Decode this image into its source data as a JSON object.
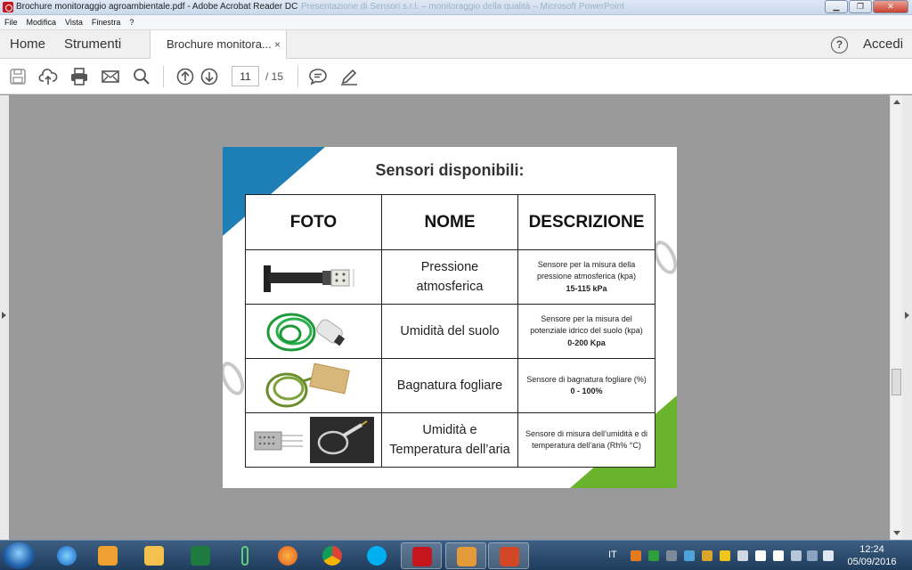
{
  "window": {
    "title": "Brochure monitoraggio agroambientale.pdf - Adobe Acrobat Reader DC",
    "background_title": "Presentazione di Sensori s.r.l. – monitoraggio della qualità – Microsoft PowerPoint"
  },
  "menu": [
    "File",
    "Modifica",
    "Vista",
    "Finestra",
    "?"
  ],
  "tabs": {
    "home": "Home",
    "tools": "Strumenti",
    "document": "Brochure monitora...",
    "close": "×",
    "signin": "Accedi",
    "help": "?"
  },
  "toolbar": {
    "icons": [
      "save-icon",
      "upload-icon",
      "print-icon",
      "email-icon",
      "search-icon",
      "arrow-up-icon",
      "arrow-down-icon",
      "comment-icon",
      "pen-icon"
    ],
    "current_page": "11",
    "total_pages": "/ 15"
  },
  "document": {
    "heading": "Sensori disponibili:",
    "columns": [
      "FOTO",
      "NOME",
      "DESCRIZIONE"
    ],
    "rows": [
      {
        "name_lines": [
          "Pressione",
          "atmosferica"
        ],
        "desc_lines": [
          "Sensore per la misura della",
          "pressione atmosferica (kpa)"
        ],
        "range": "15-115 kPa"
      },
      {
        "name_lines": [
          "Umidità del suolo"
        ],
        "desc_lines": [
          "Sensore per la misura del",
          "potenziale idrico del suolo (kpa)"
        ],
        "range": "0-200 Kpa"
      },
      {
        "name_lines": [
          "Bagnatura fogliare"
        ],
        "desc_lines": [
          "Sensore di bagnatura fogliare (%)"
        ],
        "range": "0 - 100%"
      },
      {
        "name_lines": [
          "Umidità e",
          "Temperatura dell’aria"
        ],
        "desc_lines": [
          "Sensore di misura dell’umidità e di",
          "temperatura dell’aria (Rh%  °C)"
        ],
        "range": ""
      }
    ],
    "colors": {
      "blue_corner": "#1e7fb6",
      "green_corner": "#6ab42d"
    }
  },
  "taskbar": {
    "apps": [
      "ie-icon",
      "media-player-icon",
      "explorer-icon",
      "excel-icon",
      "usb-icon",
      "firefox-icon",
      "chrome-icon",
      "skype-icon",
      "acrobat-icon",
      "paint-icon",
      "powerpoint-icon"
    ],
    "language": "IT",
    "time": "12:24",
    "date": "05/09/2016"
  }
}
